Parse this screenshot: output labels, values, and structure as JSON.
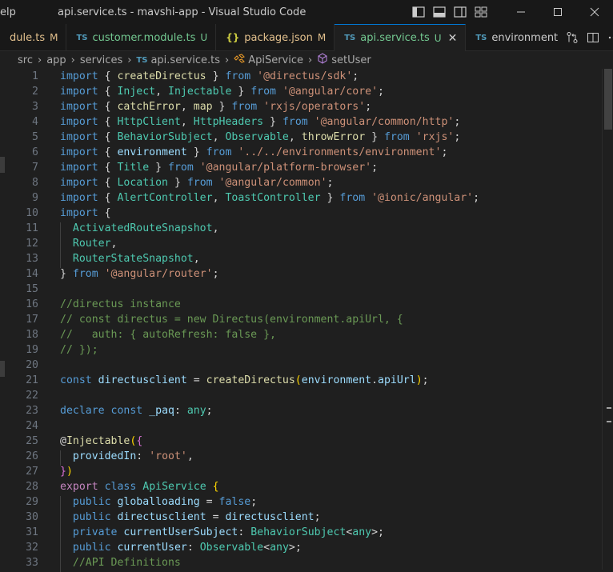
{
  "titlebar": {
    "menu_label": "elp",
    "window_title": "api.service.ts - mavshi-app - Visual Studio Code"
  },
  "tabs": [
    {
      "lang": "",
      "name": "dule.ts",
      "status": "M",
      "kind": "mod",
      "active": false
    },
    {
      "lang": "TS",
      "name": "customer.module.ts",
      "status": "U",
      "kind": "untracked",
      "active": false
    },
    {
      "lang": "{}",
      "name": "package.json",
      "status": "M",
      "kind": "mod",
      "active": false
    },
    {
      "lang": "TS",
      "name": "api.service.ts",
      "status": "U",
      "kind": "untracked",
      "active": true
    },
    {
      "lang": "TS",
      "name": "environment",
      "status": "",
      "kind": "plain",
      "active": false
    }
  ],
  "breadcrumb": {
    "seg1": "src",
    "seg2": "app",
    "seg3": "services",
    "file_lang": "TS",
    "file": "api.service.ts",
    "class": "ApiService",
    "method": "setUser"
  },
  "code": [
    {
      "n": "1",
      "t": [
        [
          "kw",
          "import"
        ],
        [
          "pun",
          " { "
        ],
        [
          "fn",
          "createDirectus"
        ],
        [
          "pun",
          " } "
        ],
        [
          "kw",
          "from"
        ],
        [
          "pun",
          " "
        ],
        [
          "str",
          "'@directus/sdk'"
        ],
        [
          "pun",
          ";"
        ]
      ]
    },
    {
      "n": "2",
      "t": [
        [
          "kw",
          "import"
        ],
        [
          "pun",
          " { "
        ],
        [
          "type",
          "Inject"
        ],
        [
          "pun",
          ", "
        ],
        [
          "type",
          "Injectable"
        ],
        [
          "pun",
          " } "
        ],
        [
          "kw",
          "from"
        ],
        [
          "pun",
          " "
        ],
        [
          "str",
          "'@angular/core'"
        ],
        [
          "pun",
          ";"
        ]
      ]
    },
    {
      "n": "3",
      "t": [
        [
          "kw",
          "import"
        ],
        [
          "pun",
          " { "
        ],
        [
          "fn",
          "catchError"
        ],
        [
          "pun",
          ", "
        ],
        [
          "fn",
          "map"
        ],
        [
          "pun",
          " } "
        ],
        [
          "kw",
          "from"
        ],
        [
          "pun",
          " "
        ],
        [
          "str",
          "'rxjs/operators'"
        ],
        [
          "pun",
          ";"
        ]
      ]
    },
    {
      "n": "4",
      "t": [
        [
          "kw",
          "import"
        ],
        [
          "pun",
          " { "
        ],
        [
          "type",
          "HttpClient"
        ],
        [
          "pun",
          ", "
        ],
        [
          "type",
          "HttpHeaders"
        ],
        [
          "pun",
          " } "
        ],
        [
          "kw",
          "from"
        ],
        [
          "pun",
          " "
        ],
        [
          "str",
          "'@angular/common/http'"
        ],
        [
          "pun",
          ";"
        ]
      ]
    },
    {
      "n": "5",
      "t": [
        [
          "kw",
          "import"
        ],
        [
          "pun",
          " { "
        ],
        [
          "type",
          "BehaviorSubject"
        ],
        [
          "pun",
          ", "
        ],
        [
          "type",
          "Observable"
        ],
        [
          "pun",
          ", "
        ],
        [
          "fn",
          "throwError"
        ],
        [
          "pun",
          " } "
        ],
        [
          "kw",
          "from"
        ],
        [
          "pun",
          " "
        ],
        [
          "str",
          "'rxjs'"
        ],
        [
          "pun",
          ";"
        ]
      ]
    },
    {
      "n": "6",
      "t": [
        [
          "kw",
          "import"
        ],
        [
          "pun",
          " { "
        ],
        [
          "var",
          "environment"
        ],
        [
          "pun",
          " } "
        ],
        [
          "kw",
          "from"
        ],
        [
          "pun",
          " "
        ],
        [
          "str",
          "'../../environments/environment'"
        ],
        [
          "pun",
          ";"
        ]
      ]
    },
    {
      "n": "7",
      "t": [
        [
          "kw",
          "import"
        ],
        [
          "pun",
          " { "
        ],
        [
          "type",
          "Title"
        ],
        [
          "pun",
          " } "
        ],
        [
          "kw",
          "from"
        ],
        [
          "pun",
          " "
        ],
        [
          "str",
          "'@angular/platform-browser'"
        ],
        [
          "pun",
          ";"
        ]
      ]
    },
    {
      "n": "8",
      "t": [
        [
          "kw",
          "import"
        ],
        [
          "pun",
          " { "
        ],
        [
          "type",
          "Location"
        ],
        [
          "pun",
          " } "
        ],
        [
          "kw",
          "from"
        ],
        [
          "pun",
          " "
        ],
        [
          "str",
          "'@angular/common'"
        ],
        [
          "pun",
          ";"
        ]
      ]
    },
    {
      "n": "9",
      "t": [
        [
          "kw",
          "import"
        ],
        [
          "pun",
          " { "
        ],
        [
          "type",
          "AlertController"
        ],
        [
          "pun",
          ", "
        ],
        [
          "type",
          "ToastController"
        ],
        [
          "pun",
          " } "
        ],
        [
          "kw",
          "from"
        ],
        [
          "pun",
          " "
        ],
        [
          "str",
          "'@ionic/angular'"
        ],
        [
          "pun",
          ";"
        ]
      ]
    },
    {
      "n": "10",
      "t": [
        [
          "kw",
          "import"
        ],
        [
          "pun",
          " {"
        ]
      ]
    },
    {
      "n": "11",
      "g": 1,
      "t": [
        [
          "pun",
          "  "
        ],
        [
          "type",
          "ActivatedRouteSnapshot"
        ],
        [
          "pun",
          ","
        ]
      ]
    },
    {
      "n": "12",
      "g": 1,
      "t": [
        [
          "pun",
          "  "
        ],
        [
          "type",
          "Router"
        ],
        [
          "pun",
          ","
        ]
      ]
    },
    {
      "n": "13",
      "g": 1,
      "t": [
        [
          "pun",
          "  "
        ],
        [
          "type",
          "RouterStateSnapshot"
        ],
        [
          "pun",
          ","
        ]
      ]
    },
    {
      "n": "14",
      "t": [
        [
          "pun",
          "} "
        ],
        [
          "kw",
          "from"
        ],
        [
          "pun",
          " "
        ],
        [
          "str",
          "'@angular/router'"
        ],
        [
          "pun",
          ";"
        ]
      ]
    },
    {
      "n": "15",
      "t": []
    },
    {
      "n": "16",
      "t": [
        [
          "cmt",
          "//directus instance"
        ]
      ]
    },
    {
      "n": "17",
      "t": [
        [
          "cmt",
          "// const directus = new Directus(environment.apiUrl, {"
        ]
      ]
    },
    {
      "n": "18",
      "t": [
        [
          "cmt",
          "//   auth: { autoRefresh: false },"
        ]
      ]
    },
    {
      "n": "19",
      "t": [
        [
          "cmt",
          "// });"
        ]
      ]
    },
    {
      "n": "20",
      "t": []
    },
    {
      "n": "21",
      "t": [
        [
          "kw",
          "const"
        ],
        [
          "pun",
          " "
        ],
        [
          "var",
          "directusclient"
        ],
        [
          "pun",
          " = "
        ],
        [
          "fn",
          "createDirectus"
        ],
        [
          "br1",
          "("
        ],
        [
          "var",
          "environment"
        ],
        [
          "pun",
          "."
        ],
        [
          "var",
          "apiUrl"
        ],
        [
          "br1",
          ")"
        ],
        [
          "pun",
          ";"
        ]
      ]
    },
    {
      "n": "22",
      "t": []
    },
    {
      "n": "23",
      "t": [
        [
          "kw",
          "declare"
        ],
        [
          "pun",
          " "
        ],
        [
          "kw",
          "const"
        ],
        [
          "pun",
          " "
        ],
        [
          "var",
          "_paq"
        ],
        [
          "pun",
          ": "
        ],
        [
          "type",
          "any"
        ],
        [
          "pun",
          ";"
        ]
      ]
    },
    {
      "n": "24",
      "t": []
    },
    {
      "n": "25",
      "t": [
        [
          "pun",
          "@"
        ],
        [
          "fn",
          "Injectable"
        ],
        [
          "br1",
          "("
        ],
        [
          "br2",
          "{"
        ]
      ]
    },
    {
      "n": "26",
      "g": 1,
      "t": [
        [
          "pun",
          "  "
        ],
        [
          "var",
          "providedIn"
        ],
        [
          "pun",
          ": "
        ],
        [
          "str",
          "'root'"
        ],
        [
          "pun",
          ","
        ]
      ]
    },
    {
      "n": "27",
      "t": [
        [
          "br2",
          "}"
        ],
        [
          "br1",
          ")"
        ]
      ]
    },
    {
      "n": "28",
      "t": [
        [
          "ctl",
          "export"
        ],
        [
          "pun",
          " "
        ],
        [
          "kw",
          "class"
        ],
        [
          "pun",
          " "
        ],
        [
          "type",
          "ApiService"
        ],
        [
          "pun",
          " "
        ],
        [
          "br1",
          "{"
        ]
      ]
    },
    {
      "n": "29",
      "g": 1,
      "t": [
        [
          "pun",
          "  "
        ],
        [
          "kw",
          "public"
        ],
        [
          "pun",
          " "
        ],
        [
          "var",
          "globalloading"
        ],
        [
          "pun",
          " = "
        ],
        [
          "kw",
          "false"
        ],
        [
          "pun",
          ";"
        ]
      ]
    },
    {
      "n": "30",
      "g": 1,
      "t": [
        [
          "pun",
          "  "
        ],
        [
          "kw",
          "public"
        ],
        [
          "pun",
          " "
        ],
        [
          "var",
          "directusclient"
        ],
        [
          "pun",
          " = "
        ],
        [
          "var",
          "directusclient"
        ],
        [
          "pun",
          ";"
        ]
      ]
    },
    {
      "n": "31",
      "g": 1,
      "t": [
        [
          "pun",
          "  "
        ],
        [
          "kw",
          "private"
        ],
        [
          "pun",
          " "
        ],
        [
          "var",
          "currentUserSubject"
        ],
        [
          "pun",
          ": "
        ],
        [
          "type",
          "BehaviorSubject"
        ],
        [
          "pun",
          "<"
        ],
        [
          "type",
          "any"
        ],
        [
          "pun",
          ">;"
        ]
      ]
    },
    {
      "n": "32",
      "g": 1,
      "t": [
        [
          "pun",
          "  "
        ],
        [
          "kw",
          "public"
        ],
        [
          "pun",
          " "
        ],
        [
          "var",
          "currentUser"
        ],
        [
          "pun",
          ": "
        ],
        [
          "type",
          "Observable"
        ],
        [
          "pun",
          "<"
        ],
        [
          "type",
          "any"
        ],
        [
          "pun",
          ">;"
        ]
      ]
    },
    {
      "n": "33",
      "g": 1,
      "t": [
        [
          "pun",
          "  "
        ],
        [
          "cmt",
          "//API Definitions"
        ]
      ]
    }
  ]
}
